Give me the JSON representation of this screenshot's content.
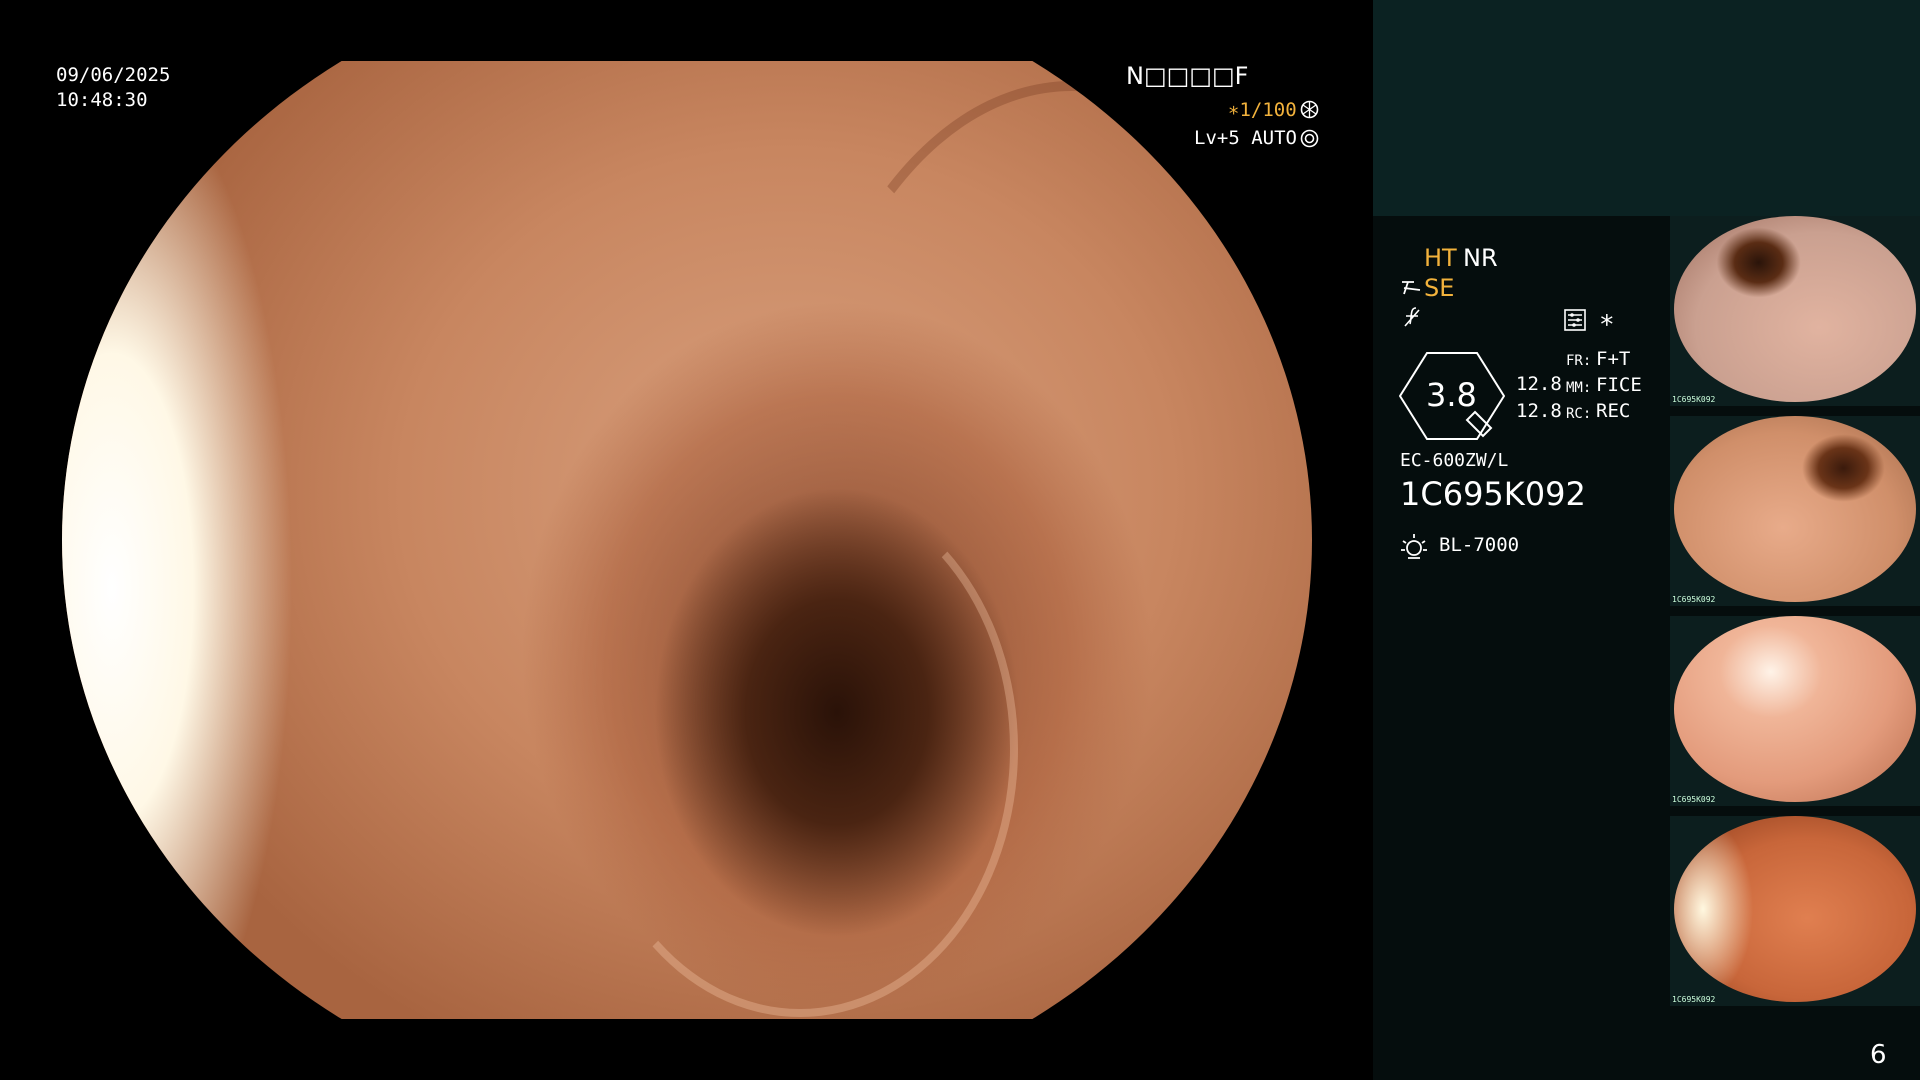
{
  "overlay": {
    "date": "09/06/2025",
    "time": "10:48:30",
    "patient_code": "N□□□□F",
    "shutter": "∗1/100",
    "shutter_icon": "shutter-icon",
    "light_level": "Lv+5 AUTO",
    "light_icon": "iris-icon"
  },
  "sidebar": {
    "ht": "HT",
    "nr": "NR",
    "se": "SE",
    "se_icon": "structure-enhance-icon",
    "f_icon": "function-icon",
    "settings_icon": "processor-settings-icon",
    "asterisk": "∗",
    "zoom_value": "3.8",
    "setting1_value": "12.8",
    "setting2_value": "12.8",
    "fr_label": "FR:",
    "fr_value": "F+T",
    "mm_label": "MM:",
    "mm_value": "FICE",
    "rc_label": "RC:",
    "rc_value": "REC",
    "scope_model": "EC-600ZW/L",
    "serial": "1C695K092",
    "light_source": "BL-7000",
    "light_source_icon": "light-source-icon",
    "page_number": "6"
  },
  "thumbnails": [
    {
      "caption": "1C695K092"
    },
    {
      "caption": "1C695K092"
    },
    {
      "caption": "1C695K092"
    },
    {
      "caption": "1C695K092"
    }
  ],
  "colors": {
    "accent": "#f2b23c",
    "sidebar_top": "#0b2222",
    "sidebar_bg": "#050d0d"
  }
}
